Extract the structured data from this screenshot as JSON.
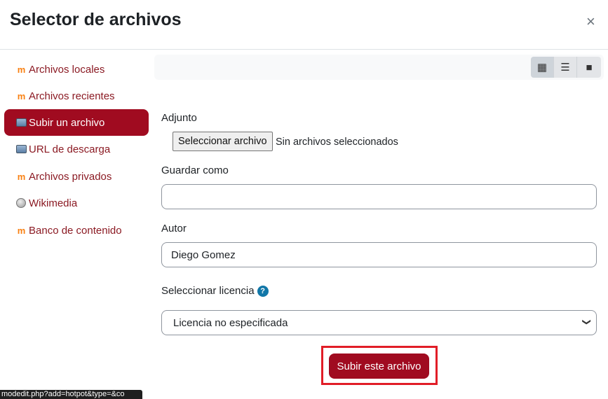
{
  "dialog": {
    "title": "Selector de archivos",
    "close_glyph": "×"
  },
  "sidebar": {
    "items": [
      {
        "label": "Archivos locales",
        "icon": "moodle-icon",
        "active": false
      },
      {
        "label": "Archivos recientes",
        "icon": "moodle-icon",
        "active": false
      },
      {
        "label": "Subir un archivo",
        "icon": "upload-icon",
        "active": true
      },
      {
        "label": "URL de descarga",
        "icon": "download-url-icon",
        "active": false
      },
      {
        "label": "Archivos privados",
        "icon": "moodle-icon",
        "active": false
      },
      {
        "label": "Wikimedia",
        "icon": "wikimedia-icon",
        "active": false
      },
      {
        "label": "Banco de contenido",
        "icon": "moodle-icon",
        "active": false
      }
    ]
  },
  "toolbar": {
    "views": [
      {
        "name": "grid-view-icon",
        "glyph": "▦"
      },
      {
        "name": "list-view-icon",
        "glyph": "☰"
      },
      {
        "name": "folder-view-icon",
        "glyph": "■"
      }
    ]
  },
  "form": {
    "attachment_label": "Adjunto",
    "file_button_label": "Seleccionar archivo",
    "file_status": "Sin archivos seleccionados",
    "save_as_label": "Guardar como",
    "save_as_value": "",
    "author_label": "Autor",
    "author_value": "Diego Gomez",
    "license_label": "Seleccionar licencia",
    "help_glyph": "?",
    "license_value": "Licencia no especificada",
    "submit_label": "Subir este archivo"
  },
  "statusbar": {
    "text": "modedit.php?add=hotpot&type=&co"
  },
  "colors": {
    "brand": "#a00b20",
    "link": "#8b1a23",
    "highlight": "#e11d27"
  }
}
